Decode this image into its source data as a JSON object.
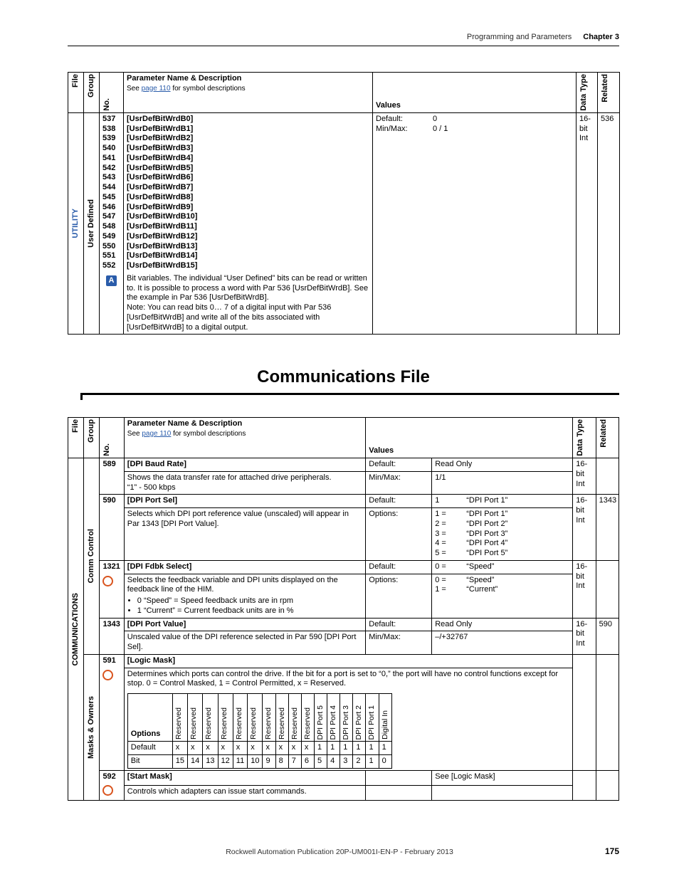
{
  "header": {
    "section": "Programming and Parameters",
    "chapter": "Chapter 3"
  },
  "table1": {
    "head": {
      "file": "File",
      "group": "Group",
      "no": "No.",
      "desc_title": "Parameter Name & Description",
      "desc_sub_pre": "See ",
      "desc_sub_link": "page 110",
      "desc_sub_post": " for symbol descriptions",
      "values": "Values",
      "datatype": "Data Type",
      "related": "Related"
    },
    "file_label": "UTILITY",
    "group_label": "User Defined",
    "numbers": [
      "537",
      "538",
      "539",
      "540",
      "541",
      "542",
      "543",
      "544",
      "545",
      "546",
      "547",
      "548",
      "549",
      "550",
      "551",
      "552"
    ],
    "names": [
      "[UsrDefBitWrdB0]",
      "[UsrDefBitWrdB1]",
      "[UsrDefBitWrdB2]",
      "[UsrDefBitWrdB3]",
      "[UsrDefBitWrdB4]",
      "[UsrDefBitWrdB5]",
      "[UsrDefBitWrdB6]",
      "[UsrDefBitWrdB7]",
      "[UsrDefBitWrdB8]",
      "[UsrDefBitWrdB9]",
      "[UsrDefBitWrdB10]",
      "[UsrDefBitWrdB11]",
      "[UsrDefBitWrdB12]",
      "[UsrDefBitWrdB13]",
      "[UsrDefBitWrdB14]",
      "[UsrDefBitWrdB15]"
    ],
    "flag": "A",
    "note1": "Bit variables. The individual “User Defined” bits can be read or written to. It is possible to process a word with Par 536 [UsrDefBitWrdB]. See the example in Par 536 [UsrDefBitWrdB].",
    "note2": "Note: You can read bits 0… 7 of a digital input with Par 536 [UsrDefBitWrdB] and write all of the bits associated with [UsrDefBitWrdB] to a digital output.",
    "vals": {
      "default_l": "Default:",
      "default_v": "0",
      "minmax_l": "Min/Max:",
      "minmax_v": "0 / 1"
    },
    "datatype": "16-bit Int",
    "related": "536"
  },
  "section_title": "Communications File",
  "table2": {
    "head": {
      "file": "File",
      "group": "Group",
      "no": "No.",
      "desc_title": "Parameter Name & Description",
      "desc_sub_pre": "See ",
      "desc_sub_link": "page 110",
      "desc_sub_post": " for symbol descriptions",
      "values": "Values",
      "datatype": "Data Type",
      "related": "Related"
    },
    "file_label": "COMMUNICATIONS",
    "group1_label": "Comm Control",
    "group2_label": "Masks & Owners",
    "rows": {
      "r589": {
        "no": "589",
        "name": "[DPI Baud Rate]",
        "desc": "Shows the data transfer rate for attached drive peripherals.",
        "desc2": "“1” - 500 kbps",
        "v_def_l": "Default:",
        "v_def_v": "Read Only",
        "v_mm_l": "Min/Max:",
        "v_mm_v": "1/1",
        "datatype": "16-bit Int",
        "related": ""
      },
      "r590": {
        "no": "590",
        "name": "[DPI Port Sel]",
        "desc": "Selects which DPI port reference value (unscaled) will appear in Par 1343 [DPI Port Value].",
        "v_def_l": "Default:",
        "v_def_v_k": "1",
        "v_def_v_t": "“DPI Port 1”",
        "v_opt_l": "Options:",
        "opts_k": [
          "1 =",
          "2 =",
          "3 =",
          "4 =",
          "5 ="
        ],
        "opts_t": [
          "“DPI Port 1”",
          "“DPI Port 2”",
          "“DPI Port 3”",
          "“DPI Port 4”",
          "“DPI Port 5”"
        ],
        "datatype": "16-bit Int",
        "related": "1343"
      },
      "r1321": {
        "no": "1321",
        "name": "[DPI Fdbk Select]",
        "desc": "Selects the feedback variable and DPI units displayed on the feedback line of the HIM.",
        "b1": "0 “Speed” = Speed feedback units are in rpm",
        "b2": "1 “Current” = Current feedback units are in %",
        "v_def_l": "Default:",
        "v_def_v_k": "0 =",
        "v_def_v_t": "“Speed”",
        "v_opt_l": "Options:",
        "opts_k": [
          "0 =",
          "1 ="
        ],
        "opts_t": [
          "“Speed”",
          "“Current”"
        ],
        "datatype": "16-bit Int",
        "related": ""
      },
      "r1343": {
        "no": "1343",
        "name": "[DPI Port Value]",
        "desc": "Unscaled value of the DPI reference selected in Par 590 [DPI Port Sel].",
        "v_def_l": "Default:",
        "v_def_v": "Read Only",
        "v_mm_l": "Min/Max:",
        "v_mm_v": "–/+32767",
        "datatype": "16-bit Int",
        "related": "590"
      },
      "r591": {
        "no": "591",
        "name": "[Logic Mask]",
        "desc": "Determines which ports can control the drive. If the bit for a port is set to “0,” the port will have no control functions except for stop. 0 = Control Masked, 1 = Control Permitted, x = Reserved.",
        "datatype": "",
        "related": ""
      },
      "r592": {
        "no": "592",
        "name": "[Start Mask]",
        "desc": "Controls which adapters can issue start commands.",
        "see": "See [Logic Mask]",
        "datatype": "",
        "related": ""
      }
    },
    "bits": {
      "head": "Options",
      "default": "Default",
      "bit": "Bit",
      "cols": [
        "Reserved",
        "Reserved",
        "Reserved",
        "Reserved",
        "Reserved",
        "Reserved",
        "Reserved",
        "Reserved",
        "Reserved",
        "Reserved",
        "DPI Port 5",
        "DPI Port 4",
        "DPI Port 3",
        "DPI Port 2",
        "DPI Port 1",
        "Digital In"
      ],
      "defaults": [
        "x",
        "x",
        "x",
        "x",
        "x",
        "x",
        "x",
        "x",
        "x",
        "x",
        "1",
        "1",
        "1",
        "1",
        "1",
        "1"
      ],
      "nums": [
        "15",
        "14",
        "13",
        "12",
        "11",
        "10",
        "9",
        "8",
        "7",
        "6",
        "5",
        "4",
        "3",
        "2",
        "1",
        "0"
      ]
    }
  },
  "footer": {
    "pub": "Rockwell Automation Publication 20P-UM001I-EN-P - February 2013",
    "page": "175"
  }
}
